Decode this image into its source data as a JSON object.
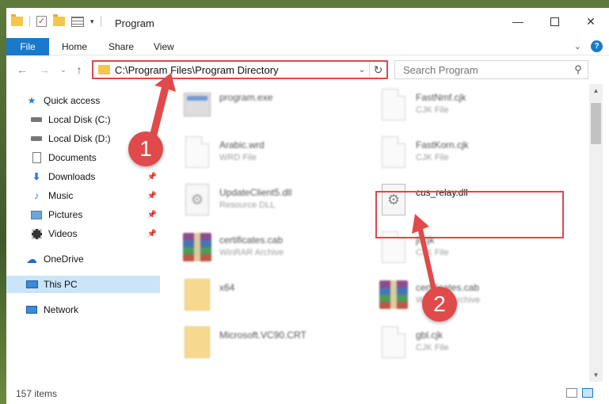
{
  "window": {
    "title": "Program",
    "minimize_icon": "minimize-icon",
    "maximize_icon": "maximize-icon",
    "close_icon": "close-icon"
  },
  "ribbon": {
    "tabs": [
      "File",
      "Home",
      "Share",
      "View"
    ]
  },
  "address": {
    "path": "C:\\Program Files\\Program Directory"
  },
  "search": {
    "placeholder": "Search Program"
  },
  "sidebar": {
    "items": [
      {
        "label": "Quick access",
        "icon": "star-icon"
      },
      {
        "label": "Local Disk (C:)",
        "icon": "drive-icon"
      },
      {
        "label": "Local Disk (D:)",
        "icon": "drive-icon"
      },
      {
        "label": "Documents",
        "icon": "documents-icon"
      },
      {
        "label": "Downloads",
        "icon": "downloads-icon"
      },
      {
        "label": "Music",
        "icon": "music-icon"
      },
      {
        "label": "Pictures",
        "icon": "pictures-icon"
      },
      {
        "label": "Videos",
        "icon": "videos-icon"
      },
      {
        "label": "OneDrive",
        "icon": "cloud-icon"
      },
      {
        "label": "This PC",
        "icon": "computer-icon"
      },
      {
        "label": "Network",
        "icon": "network-icon"
      }
    ]
  },
  "files": [
    {
      "name": "program.exe",
      "type": ""
    },
    {
      "name": "FastNmf.cjk",
      "type": "CJK File"
    },
    {
      "name": "Arabic.wrd",
      "type": "WRD File"
    },
    {
      "name": "FastKorn.cjk",
      "type": "CJK File"
    },
    {
      "name": "UpdateClient5.dll",
      "type": "Resource DLL"
    },
    {
      "name": "cus_relay.dll",
      "type": ""
    },
    {
      "name": "certificates.cab",
      "type": "WinRAR Archive"
    },
    {
      "name": "jl.cjk",
      "type": "CJK File"
    },
    {
      "name": "x64",
      "type": ""
    },
    {
      "name": "certificates.cab",
      "type": "WinRAR Archive"
    },
    {
      "name": "Microsoft.VC90.CRT",
      "type": ""
    },
    {
      "name": "gbl.cjk",
      "type": "CJK File"
    }
  ],
  "status": {
    "count": "157 items"
  },
  "annotations": {
    "step1": "1",
    "step2": "2",
    "accent": "#e0464e"
  },
  "colors": {
    "file_tab": "#1979ca",
    "selected": "#cce4f7"
  }
}
